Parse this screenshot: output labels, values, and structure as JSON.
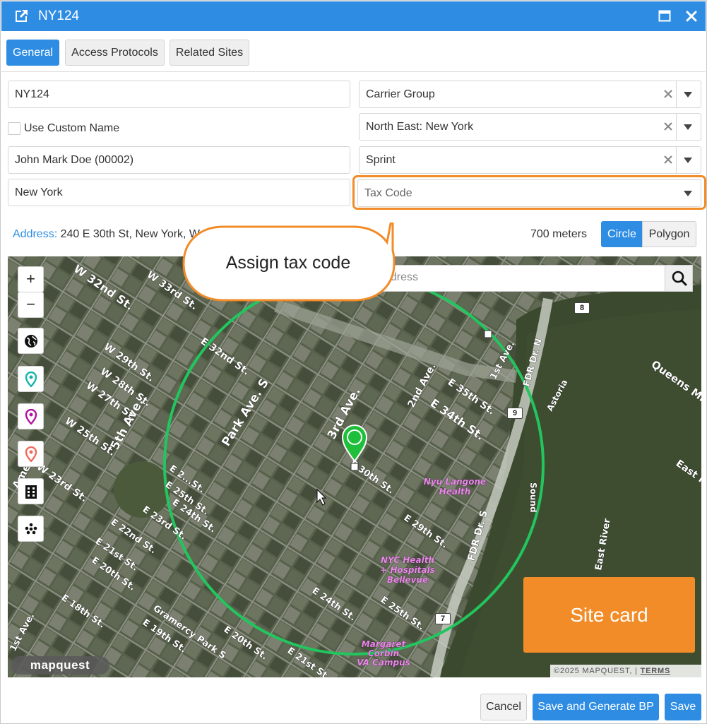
{
  "window": {
    "title": "NY124",
    "title_icon": "external-link-icon",
    "maximize_icon": "maximize-icon",
    "close_icon": "close-icon"
  },
  "tabs": [
    {
      "label": "General",
      "active": true
    },
    {
      "label": "Access Protocols",
      "active": false
    },
    {
      "label": "Related Sites",
      "active": false
    }
  ],
  "form": {
    "site_name": "NY124",
    "use_custom_name": {
      "label": "Use Custom Name",
      "checked": false
    },
    "contact": "John Mark Doe (00002)",
    "city": "New York",
    "carrier_group": "Carrier Group",
    "region": "North East: New York",
    "carrier": "Sprint",
    "tax_code_placeholder": "Tax Code"
  },
  "address": {
    "label": "Address:",
    "value": "240 E 30th St, New York, W"
  },
  "radius": {
    "value": "700 meters",
    "circle_label": "Circle",
    "polygon_label": "Polygon",
    "selected": "Circle"
  },
  "map": {
    "search_placeholder": "ddress",
    "zoom_in": "+",
    "zoom_out": "−",
    "tools": [
      "globe-icon",
      "pin-teal-icon",
      "pin-magenta-icon",
      "pin-salmon-icon",
      "building-icon",
      "cluster-icon"
    ],
    "street_labels": [
      "W 32nd St.",
      "W 33rd St.",
      "W 29th St.",
      "W 28th St.",
      "W 27th St.",
      "W 25th St.",
      "W 23rd St.",
      "E 32nd St.",
      "Park Ave. S",
      "3rd Ave.",
      "2nd Ave.",
      "1st Ave.",
      "E 35th St.",
      "E 34th St.",
      "FDR Dr. N",
      "FDR Dr. S",
      "Queens Midt",
      "Astoria",
      "East Riv",
      "East River",
      "Nyu Langone Health",
      "NYC Health + Hospitals Bellevue",
      "Margaret Corbin VA Campus",
      "5th Ave.",
      "E 24th St.",
      "E 25th St.",
      "E 29th St.",
      "E 22nd St.",
      "E 21st St.",
      "E 20th St.",
      "E 18th St.",
      "E 19th St.",
      "E 23rd St.",
      "Gramercy Park S",
      "Sound",
      "8",
      "9",
      "7"
    ],
    "logo": "mapquest",
    "copyright": "©2025 MAPQUEST,",
    "terms": "TERMS",
    "circle_color": "#22c55e",
    "marker_color": "#1fbf3b"
  },
  "annotations": {
    "callout": "Assign tax code",
    "site_card": "Site card",
    "accent": "#f28c28"
  },
  "footer": {
    "cancel": "Cancel",
    "save_generate": "Save and Generate BP",
    "save": "Save"
  }
}
